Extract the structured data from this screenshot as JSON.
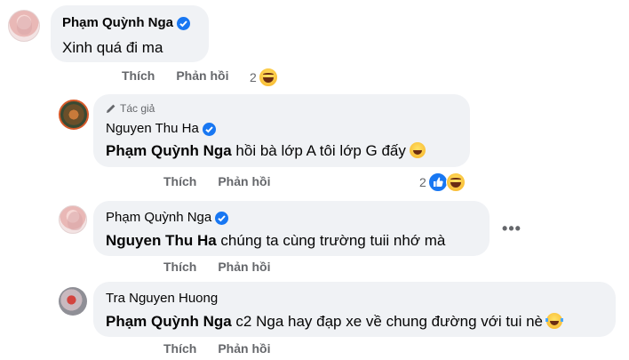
{
  "comments": [
    {
      "author": "Phạm Quỳnh Nga",
      "verified": true,
      "text": "Xinh quá đi ma",
      "actions": {
        "like": "Thích",
        "reply": "Phản hồi"
      },
      "reaction_count": "2",
      "reactions": [
        "haha-emoji"
      ]
    },
    {
      "author_tag": "Tác giả",
      "author": "Nguyen Thu Ha",
      "verified": true,
      "mention": "Phạm Quỳnh Nga",
      "text": "hồi bà lớp A tôi lớp G đấy",
      "actions": {
        "like": "Thích",
        "reply": "Phản hồi"
      },
      "reaction_count": "2",
      "reactions": [
        "like-emoji",
        "haha-emoji"
      ]
    },
    {
      "author": "Phạm Quỳnh Nga",
      "verified": true,
      "mention": "Nguyen Thu Ha",
      "text": "chúng ta cùng trường tuii nhớ mà",
      "more_label": "•••",
      "actions": {
        "like": "Thích",
        "reply": "Phản hồi"
      }
    },
    {
      "author": "Tra Nguyen Huong",
      "verified": false,
      "mention": "Phạm Quỳnh Nga",
      "text": "c2 Nga hay đạp xe về chung đường với tui nè",
      "actions": {
        "like": "Thích",
        "reply": "Phản hồi"
      }
    }
  ],
  "colors": {
    "bubble": "#f0f2f5",
    "secondary_text": "#65676b",
    "verified_blue": "#1877f2"
  }
}
